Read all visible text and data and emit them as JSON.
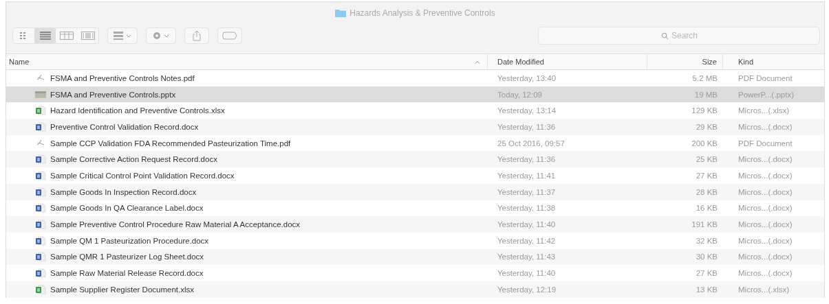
{
  "window": {
    "title": "Hazards Analysis & Preventive Controls"
  },
  "toolbar": {
    "view_buttons": [
      {
        "kind": "icons",
        "selected": false
      },
      {
        "kind": "list",
        "selected": true
      },
      {
        "kind": "columns",
        "selected": false
      },
      {
        "kind": "gallery",
        "selected": false
      }
    ],
    "search": {
      "placeholder": "Search"
    }
  },
  "table": {
    "columns": [
      {
        "label": "Name",
        "sorted": true
      },
      {
        "label": "Date Modified",
        "sorted": false
      },
      {
        "label": "Size",
        "sorted": false
      },
      {
        "label": "Kind",
        "sorted": false
      }
    ],
    "rows": [
      {
        "kind": "pdf",
        "selected": false,
        "name": "FSMA and Preventive Controls Notes.pdf",
        "date": "Yesterday, 13:40",
        "size": "5.2 MB",
        "type": "PDF Document"
      },
      {
        "kind": "pptx",
        "selected": true,
        "name": "FSMA and Preventive Controls.pptx",
        "date": "Today, 12:09",
        "size": "19 MB",
        "type": "PowerP...(.pptx)"
      },
      {
        "kind": "xlsx",
        "selected": false,
        "name": "Hazard Identification and Preventive Controls.xlsx",
        "date": "Yesterday, 13:14",
        "size": "129 KB",
        "type": "Micros...(.xlsx)"
      },
      {
        "kind": "docx",
        "selected": false,
        "name": "Preventive Control Validation Record.docx",
        "date": "Yesterday, 11:36",
        "size": "29 KB",
        "type": "Micros...(.docx)"
      },
      {
        "kind": "pdf",
        "selected": false,
        "name": "Sample CCP Validation FDA Recommended Pasteurization Time.pdf",
        "date": "25 Oct 2016, 09:57",
        "size": "200 KB",
        "type": "PDF Document"
      },
      {
        "kind": "docx",
        "selected": false,
        "name": "Sample Corrective Action Request Record.docx",
        "date": "Yesterday, 11:36",
        "size": "25 KB",
        "type": "Micros...(.docx)"
      },
      {
        "kind": "docx",
        "selected": false,
        "name": "Sample Critical Control Point Validation Record.docx",
        "date": "Yesterday, 11:41",
        "size": "27 KB",
        "type": "Micros...(.docx)"
      },
      {
        "kind": "docx",
        "selected": false,
        "name": "Sample Goods In Inspection Record.docx",
        "date": "Yesterday, 11:37",
        "size": "28 KB",
        "type": "Micros...(.docx)"
      },
      {
        "kind": "docx",
        "selected": false,
        "name": "Sample Goods In QA Clearance Label.docx",
        "date": "Yesterday, 11:38",
        "size": "16 KB",
        "type": "Micros...(.docx)"
      },
      {
        "kind": "docx",
        "selected": false,
        "name": "Sample Preventive Control Procedure Raw Material A Acceptance.docx",
        "date": "Yesterday, 11:40",
        "size": "191 KB",
        "type": "Micros...(.docx)"
      },
      {
        "kind": "docx",
        "selected": false,
        "name": "Sample QM 1 Pasteurization Procedure.docx",
        "date": "Yesterday, 11:42",
        "size": "32 KB",
        "type": "Micros...(.docx)"
      },
      {
        "kind": "docx",
        "selected": false,
        "name": "Sample QMR 1 Pasteurizer Log Sheet.docx",
        "date": "Yesterday, 11:43",
        "size": "30 KB",
        "type": "Micros...(.docx)"
      },
      {
        "kind": "docx",
        "selected": false,
        "name": "Sample Raw Material Release Record.docx",
        "date": "Yesterday, 11:40",
        "size": "27 KB",
        "type": "Micros...(.docx)"
      },
      {
        "kind": "xlsx",
        "selected": false,
        "name": "Sample Supplier Register Document.xlsx",
        "date": "Yesterday, 12:19",
        "size": "13 KB",
        "type": "Micros...(.xlsx)"
      }
    ]
  }
}
